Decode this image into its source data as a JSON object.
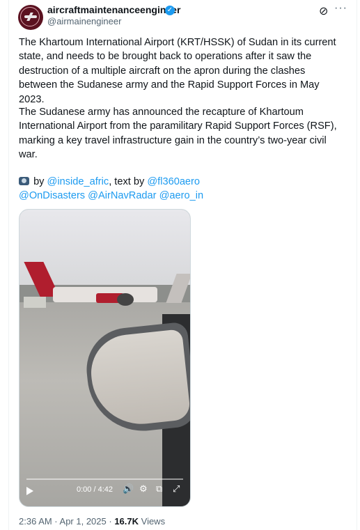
{
  "author": {
    "name": "aircraftmaintenanceengineer",
    "handle": "@airmainengineer",
    "verified_glyph": "✓"
  },
  "post": {
    "paragraph1": "The Khartoum International Airport (KRT/HSSK) of Sudan in its current state, and needs to be brought back to operations after it saw the destruction of a multiple aircraft on the apron during the clashes between the Sudanese army and the Rapid Support Forces in May 2023.",
    "paragraph2": "The Sudanese army has announced the recapture of Khartoum International Airport from the paramilitary Rapid Support Forces (RSF), marking a key travel infrastructure gain in the country’s two-year civil war.",
    "credit_by": "by",
    "credit_user1": "@inside_afric",
    "credit_text_by": ", text by",
    "credit_user2": "@fl360aero",
    "mention1": "@OnDisasters",
    "mention2": "@AirNavRadar",
    "mention3": "@aero_in"
  },
  "video": {
    "time": "0:00 / 4:42"
  },
  "footer": {
    "time": "2:36 AM · Apr 1, 2025 · ",
    "views_count": "16.7K",
    "views_label": " Views"
  },
  "icons": {
    "grok": "⊘",
    "more": "···",
    "volume": "🔊",
    "settings": "⚙",
    "captions": "⧉",
    "fullscreen": "⤢"
  },
  "colors": {
    "link": "#1d9bf0",
    "verified": "#1d9bf0",
    "text": "#0f1419",
    "muted": "#536471"
  }
}
